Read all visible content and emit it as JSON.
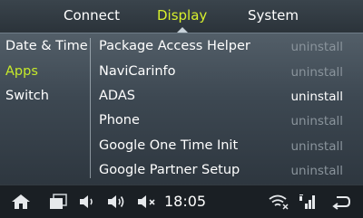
{
  "tabs": [
    {
      "label": "Connect",
      "active": false
    },
    {
      "label": "Display",
      "active": true
    },
    {
      "label": "System",
      "active": false
    }
  ],
  "left_menu": [
    {
      "label": "Date & Time",
      "active": false
    },
    {
      "label": "Apps",
      "active": true
    },
    {
      "label": "Switch",
      "active": false
    }
  ],
  "apps": [
    {
      "name": "Package Access Helper",
      "action": "uninstall",
      "enabled": false
    },
    {
      "name": "NaviCarinfo",
      "action": "uninstall",
      "enabled": false
    },
    {
      "name": "ADAS",
      "action": "uninstall",
      "enabled": true
    },
    {
      "name": "Phone",
      "action": "uninstall",
      "enabled": false
    },
    {
      "name": "Google One Time Init",
      "action": "uninstall",
      "enabled": false
    },
    {
      "name": "Google Partner Setup",
      "action": "uninstall",
      "enabled": false
    }
  ],
  "status": {
    "time": "18:05"
  },
  "icons": [
    "home-icon",
    "recent-apps-icon",
    "volume-down-icon",
    "volume-up-icon",
    "mute-icon",
    "wifi-off-icon",
    "signal-icon",
    "back-icon"
  ],
  "colors": {
    "accent": "#d7f02c",
    "disabled_text": "#8a949c"
  }
}
